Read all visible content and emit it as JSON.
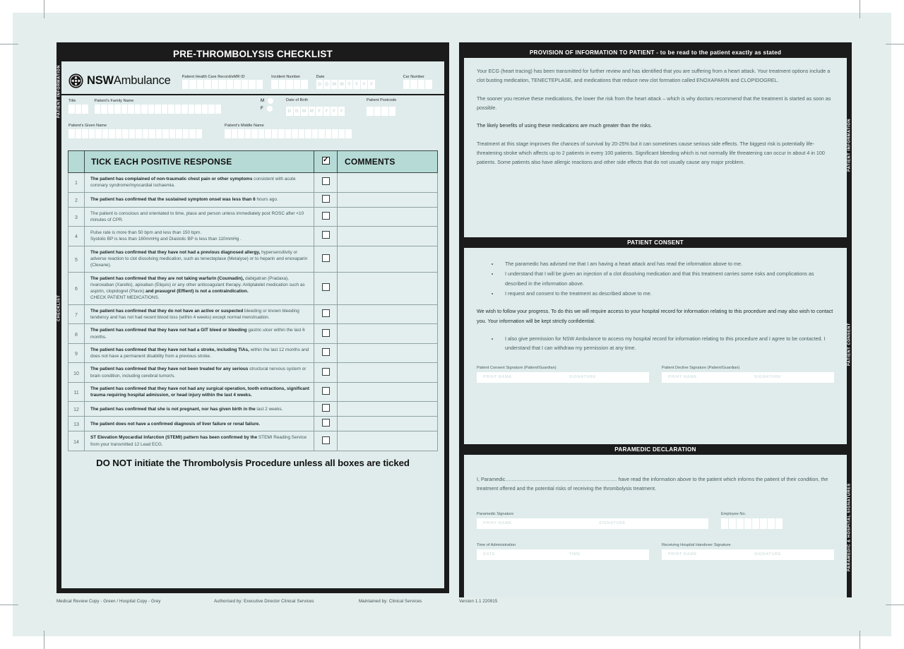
{
  "colors": {
    "paper": "#e4eeed",
    "panel_bg": "#dfeceb",
    "ink": "#1b1b1b",
    "header_teal": "#b6dbd6",
    "field_white": "#ffffff"
  },
  "left_panel": {
    "title": "PRE-THROMBOLYSIS CHECKLIST",
    "side_tabs": [
      "PATIENT INFORMATION",
      "CHECKLIST"
    ],
    "brand": {
      "nsw": "NSW",
      "ambulance": "Ambulance",
      "icon": "maltese-cross-icon"
    },
    "fields": {
      "phcr_label": "Patient Health Care Record/eMR ID",
      "phcr_boxes": 11,
      "incident_label": "Incident Number",
      "incident_boxes": 5,
      "date_label": "Date",
      "date_ghost": [
        "D",
        "D",
        "M",
        "M",
        "Y",
        "Y",
        "Y",
        "Y"
      ],
      "car_label": "Car Number",
      "car_boxes": 4,
      "title_label": "Title",
      "title_boxes": 3,
      "family_name_label": "Patient's Family Name",
      "family_name_boxes": 19,
      "sex_m": "M",
      "sex_f": "F",
      "dob_label": "Date of Birth",
      "dob_ghost": [
        "D",
        "D",
        "M",
        "M",
        "Y",
        "Y",
        "Y",
        "Y"
      ],
      "postcode_label": "Patient Postcode",
      "postcode_boxes": 4,
      "given_name_label": "Patient's Given Name",
      "given_name_boxes": 20,
      "middle_name_label": "Patient's Middle Name",
      "middle_name_boxes": 19
    },
    "table": {
      "header_num": "",
      "header_text": "TICK EACH POSITIVE RESPONSE",
      "header_tick": "checked-box-icon",
      "header_comments": "COMMENTS",
      "rows": [
        {
          "n": "1",
          "strong": "The patient has complained of non-traumatic chest pain or other symptoms",
          "rest": "consistent with acute coronary syndrome/myocardial ischaemia."
        },
        {
          "n": "2",
          "strong": "The patient has confirmed that the sustained symptom onset was less than 6",
          "rest": "hours ago."
        },
        {
          "n": "3",
          "strong": "",
          "rest": "The patient is conscious and orientated to time, place and person unless immediately post ROSC after <10 minutes of CPR."
        },
        {
          "n": "4",
          "strong": "",
          "rest": "Pulse rate is more than 50 bpm and less than 150 bpm.\nSystolic BP is less than 180mmHg and Diastolic BP is less than 110mmHg ."
        },
        {
          "n": "5",
          "strong": "The patient has confirmed that they have not had a previous diagnosed allergy,",
          "rest": "hypersensitivity or adverse reaction to clot dissolving medication, such as tenecteplase (Metalyse) or to heparin and enoxaparin (Clexane)."
        },
        {
          "n": "6",
          "strong": "The patient has confirmed that they are not taking warfarin (Coumadin),",
          "rest": "dabigatran (Pradaxa), rivaroxaban (Xarelto), apixaban (Eliquis) or any other anticoagulant therapy. Antiplatelet medication such as aspirin, clopidogrel (Plavix)",
          "strong2": "and prasugrel (Effient) is not a contraindication.",
          "rest2": "CHECK PATIENT MEDICATIONS."
        },
        {
          "n": "7",
          "strong": "The patient has confirmed that they do not have an active or suspected",
          "rest": "bleeding or known bleeding tendency and has not had recent blood loss (within 4 weeks) except normal menstruation."
        },
        {
          "n": "8",
          "strong": "The patient has confirmed that they have not had a GIT bleed or bleeding",
          "rest": "gastric ulcer within the last 6 months."
        },
        {
          "n": "9",
          "strong": "The patient has confirmed that they have not had a stroke, including TIAs,",
          "rest": "within the last 12 months and does not have a permanent disability from a previous stroke."
        },
        {
          "n": "10",
          "strong": "The patient has confirmed that they have not been treated for any serious",
          "rest": "structural nervous system or brain condition, including cerebral tumor/s."
        },
        {
          "n": "11",
          "strong": "The patient has confirmed that they have not had any surgical operation, tooth extractions, significant trauma requiring hospital admission, or head injury within the last 4 weeks.",
          "rest": ""
        },
        {
          "n": "12",
          "strong": "The patient has confirmed that she is not pregnant, nor has given birth in the",
          "rest": "last 2 weeks."
        },
        {
          "n": "13",
          "strong": "The patient does not have a confirmed diagnosis of liver failure or renal failure.",
          "rest": ""
        },
        {
          "n": "14",
          "strong": "ST Elevation Myocardial Infarction (STEMI) pattern has been confirmed by the",
          "rest": "STEMI Reading Service from your transmitted 12 Lead ECG."
        }
      ]
    },
    "warning": "DO NOT initiate the Thrombolysis Procedure unless all boxes are ticked",
    "footer": [
      "Medical Review Copy - Green  / Hospital Copy - Grey",
      "Authorised by: Executive Director Clinical Services",
      "Maintained by: Clinical Services"
    ]
  },
  "right_panel": {
    "side_tabs": [
      "PATIENT INFORMATION",
      "PATIENT CONSENT",
      "PARAMEDIC & HOSPITAL SIGNATURES"
    ],
    "provision": {
      "heading": "PROVISION OF INFORMATION TO PATIENT - to be read to the patient exactly as stated",
      "paragraphs": [
        "Your ECG (heart tracing) has been transmitted for further review and has identified that you are suffering from a heart attack. Your treatment options include a clot busting medication, TENECTEPLASE, and medications that reduce new clot formation called ENOXAPARIN and CLOPIDOGREL.",
        "The sooner you receive these medications, the lower the risk from the heart attack – which is why doctors recommend that the treatment is started as soon as possible.",
        "The likely benefits of using these medications are much greater than the risks.",
        "Treatment at this stage improves the chances of survival by 20-25% but it can sometimes cause serious side effects. The biggest risk is potentially life-threatening stroke which affects up to 2 patients in every 100 patients. Significant bleeding which is not normally life threatening can occur in about 4 in 100 patients. Some patients also have allergic reactions and other side effects that do not usually cause any major problem."
      ]
    },
    "consent": {
      "heading": "PATIENT CONSENT",
      "bullets": [
        "The paramedic has advised me that I am having a heart attack and has read the information above to me.",
        "I understand that I will be given an injection of a clot dissolving medication and that this treatment carries some risks and complications as described in the information above.",
        "I request and consent to the treatment as described above to me."
      ],
      "paragraph": "We wish to follow your progress. To do this we will require access to your hospital record for information relating to this procedure and may also wish to contact you. Your information will be kept strictly confidential.",
      "bullets2": [
        "I also give permission for NSW Ambulance to access my hospital record for information relating to this procedure and I agree to be contacted. I understand that I can withdraw my permission at any time."
      ],
      "sig_consent_label": "Patient Consent Signature (Patient/Guardian)",
      "sig_decline_label": "Patient Decline Signature (Patient/Guardian)",
      "print_name_placeholder": "PRINT NAME",
      "signature_placeholder": "SIGNATURE"
    },
    "declaration": {
      "heading": "PARAMEDIC DECLARATION",
      "intro": "I, Paramedic",
      "dots": "........................................................................................",
      "body": " have read the information above to the patient which informs the patient of their condition, the treatment offered and the potential risks of receiving the thrombolysis treatment.",
      "paramedic_sig_label": "Paramedic Signature",
      "employee_no_label": "Employee No.",
      "employee_boxes": 8,
      "time_admin_label": "Time of Administration",
      "handover_label": "Receiving Hospital Handover Signature",
      "print_name_placeholder": "PRINT NAME",
      "signature_placeholder": "SIGNATURE",
      "date_placeholder": "DATE",
      "time_placeholder": "TIME"
    },
    "version": "Version 1.1 220915"
  }
}
